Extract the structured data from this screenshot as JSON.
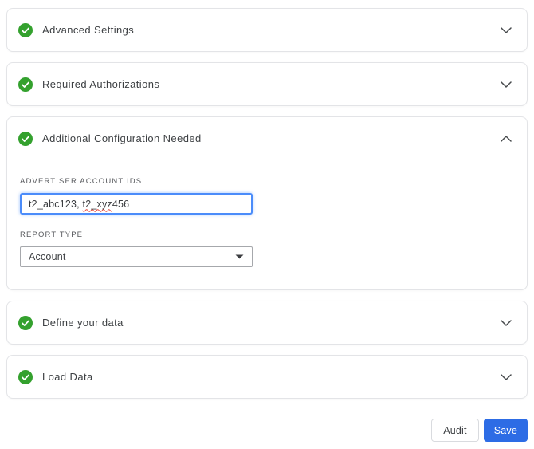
{
  "accordion": {
    "panels": [
      {
        "title": "Advanced Settings",
        "status_icon": "check-circle",
        "chevron": "down",
        "expanded": false
      },
      {
        "title": "Required Authorizations",
        "status_icon": "check-circle",
        "chevron": "down",
        "expanded": false
      },
      {
        "title": "Additional Configuration Needed",
        "status_icon": "check-circle",
        "chevron": "up",
        "expanded": true
      },
      {
        "title": "Define your data",
        "status_icon": "check-circle",
        "chevron": "down",
        "expanded": false
      },
      {
        "title": "Load Data",
        "status_icon": "check-circle",
        "chevron": "down",
        "expanded": false
      }
    ]
  },
  "form": {
    "advertiser_account_ids": {
      "label": "ADVERTISER ACCOUNT IDS",
      "value": "t2_abc123, t2_xyz456",
      "value_segments": {
        "plain_before": "t2_abc123, ",
        "spellcheck_flagged": "t2_xyz",
        "plain_after": "456"
      }
    },
    "report_type": {
      "label": "REPORT TYPE",
      "selected_option": "Account"
    }
  },
  "actions": {
    "audit_label": "Audit",
    "save_label": "Save"
  },
  "colors": {
    "status_green": "#34a12e",
    "save_blue": "#2d6ce5",
    "input_focus_blue": "#4b8cfa",
    "spellcheck_red": "#e8493f",
    "panel_border": "#e3e4e7"
  }
}
